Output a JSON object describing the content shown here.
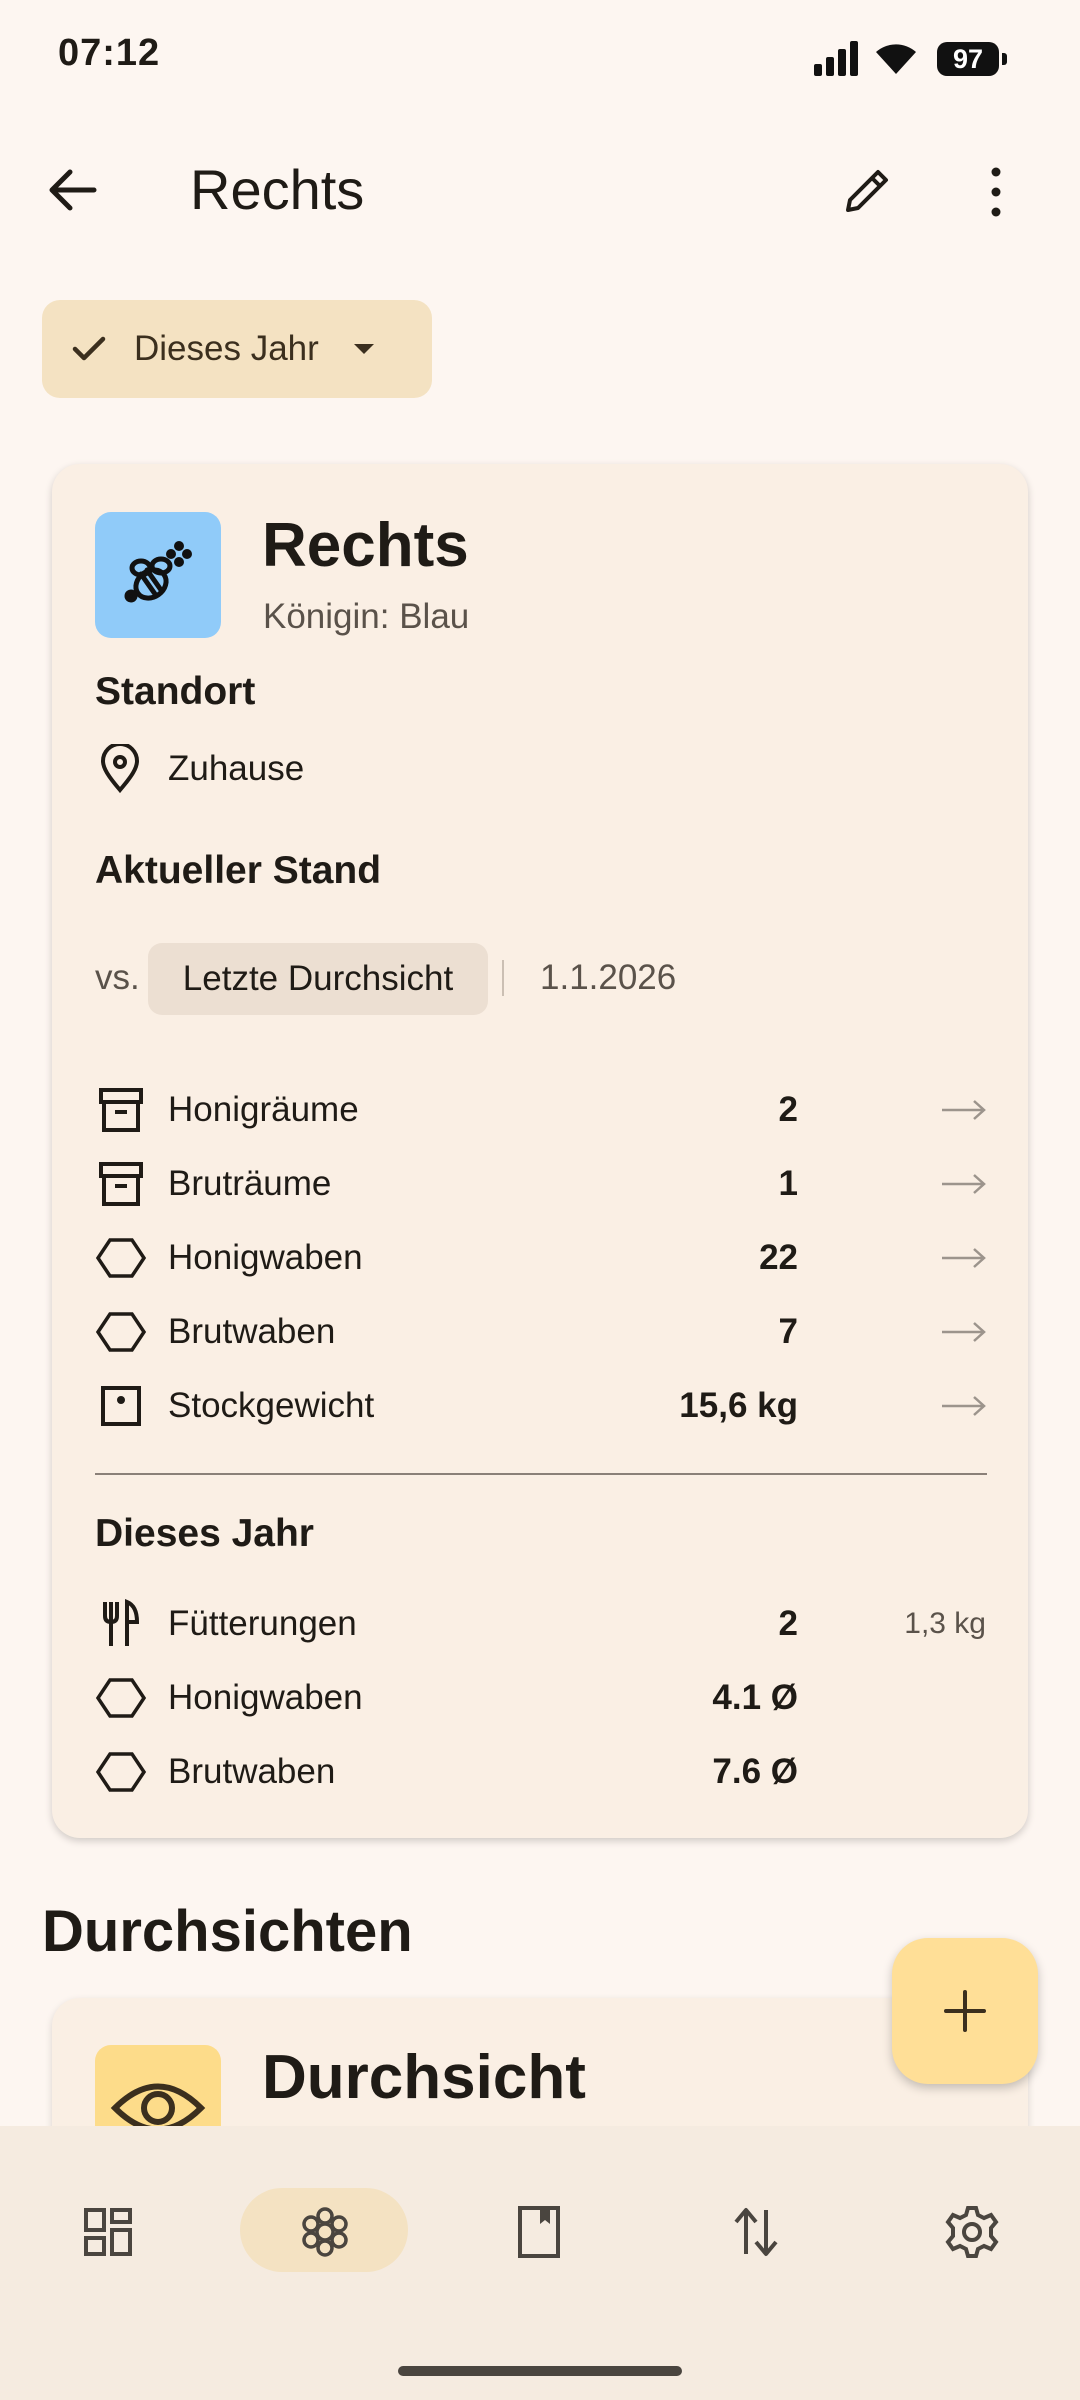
{
  "status_bar": {
    "time": "07:12",
    "battery": "97"
  },
  "app_bar": {
    "title": "Rechts"
  },
  "filter_chip": {
    "label": "Dieses Jahr"
  },
  "hive_card": {
    "name": "Rechts",
    "queen": "Königin: Blau",
    "location_heading": "Standort",
    "location": "Zuhause",
    "status_heading": "Aktueller Stand",
    "vs_label": "vs.",
    "compare_chip": "Letzte Durchsicht",
    "compare_date": "1.1.2026",
    "current_rows": [
      {
        "icon": "archive-box-icon",
        "label": "Honigräume",
        "value": "2"
      },
      {
        "icon": "archive-box-icon",
        "label": "Bruträume",
        "value": "1"
      },
      {
        "icon": "hexagon-icon",
        "label": "Honigwaben",
        "value": "22"
      },
      {
        "icon": "hexagon-icon",
        "label": "Brutwaben",
        "value": "7"
      },
      {
        "icon": "scale-icon",
        "label": "Stockgewicht",
        "value": "15,6 kg"
      }
    ],
    "year_heading": "Dieses Jahr",
    "year_rows": [
      {
        "icon": "fork-knife-icon",
        "label": "Fütterungen",
        "value": "2",
        "extra": "1,3 kg"
      },
      {
        "icon": "hexagon-icon",
        "label": "Honigwaben",
        "value": "4.1 Ø"
      },
      {
        "icon": "hexagon-icon",
        "label": "Brutwaben",
        "value": "7.6 Ø"
      }
    ]
  },
  "inspections": {
    "heading": "Durchsichten",
    "first_item_title": "Durchsicht"
  },
  "bottom_nav": [
    "dashboard-icon",
    "hive-icon",
    "book-icon",
    "transfer-icon",
    "settings-icon"
  ],
  "colors": {
    "accent": "#f4e2c2",
    "hive_icon_bg": "#90cbf9",
    "fab": "#ffdf97"
  }
}
